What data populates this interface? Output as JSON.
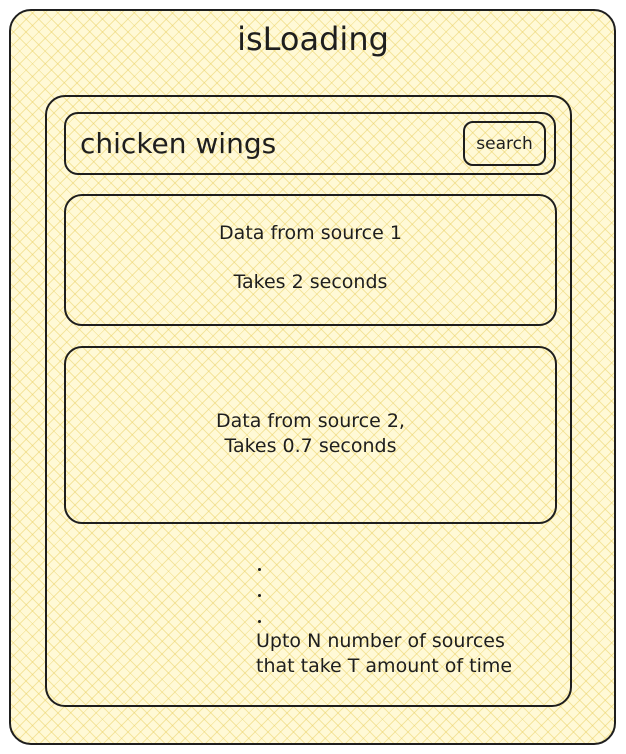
{
  "title": "isLoading",
  "search": {
    "query": "chicken wings",
    "button_label": "search"
  },
  "cards": [
    {
      "line1": "Data from source 1",
      "line2": "Takes 2 seconds"
    },
    {
      "line1": "Data from source 2,",
      "line2": "Takes 0.7 seconds"
    }
  ],
  "note": {
    "line1": "Upto N number of sources",
    "line2": "that take T amount of time"
  },
  "colors": {
    "fill": "#fff9d6",
    "hatch": "#e8cd5a",
    "stroke": "#1e1e1e"
  }
}
